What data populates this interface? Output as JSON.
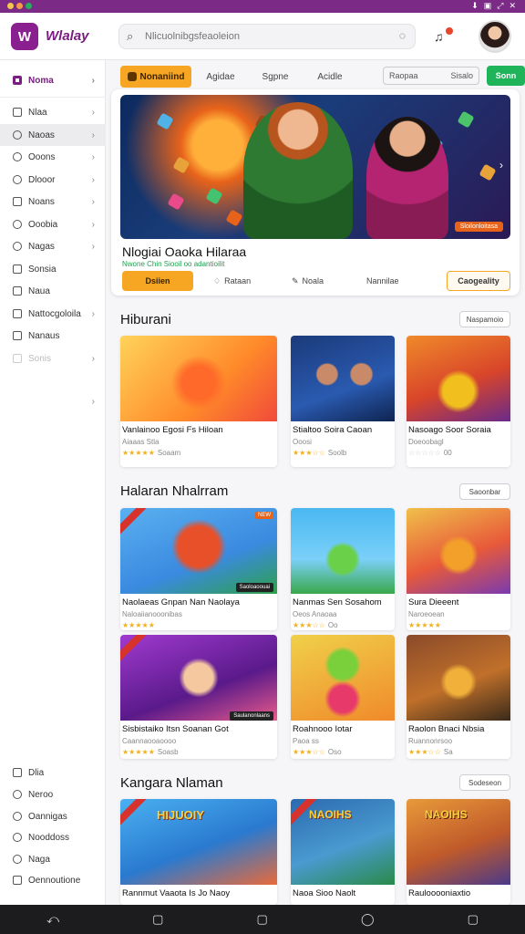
{
  "app": {
    "logo_text": "Wlalay",
    "logo_mark": "W"
  },
  "search": {
    "placeholder": "Nlicuolnibgsfeaoleion"
  },
  "colors": {
    "brand": "#7a1d80",
    "accent": "#f6a623",
    "green": "#1fb35a"
  },
  "sidebar": {
    "items": [
      {
        "label": "Noma",
        "icon": "home-icon"
      },
      {
        "label": "Nlaa",
        "icon": "grid-icon"
      },
      {
        "label": "Naoas",
        "icon": "bell-icon"
      },
      {
        "label": "Ooons",
        "icon": "star-icon"
      },
      {
        "label": "Dlooor",
        "icon": "folder-icon"
      },
      {
        "label": "Noans",
        "icon": "list-icon"
      },
      {
        "label": "Ooobia",
        "icon": "chat-icon"
      },
      {
        "label": "Nagas",
        "icon": "tag-icon"
      },
      {
        "label": "Sonsia",
        "icon": "gift-icon"
      },
      {
        "label": "Naua",
        "icon": "mail-icon"
      },
      {
        "label": "Nattocgoloila",
        "icon": "trophy-icon"
      },
      {
        "label": "Nanaus",
        "icon": "doc-icon"
      },
      {
        "label": "Sonis",
        "icon": "faded-icon"
      }
    ],
    "bottom_items": [
      {
        "label": "Dlia",
        "icon": "info-icon"
      },
      {
        "label": "Neroo",
        "icon": "help-icon"
      },
      {
        "label": "Oannigas",
        "icon": "settings-icon"
      },
      {
        "label": "Nooddoss",
        "icon": "user-icon"
      },
      {
        "label": "Naga",
        "icon": "globe-icon"
      },
      {
        "label": "Oennoutione",
        "icon": "logout-icon"
      }
    ]
  },
  "tabs": {
    "items": [
      "Nonaniind",
      "Agidae",
      "Sgpne",
      "Acidle"
    ],
    "filter_left": "Raopaa",
    "filter_right": "Sisalo",
    "action": "Sonn"
  },
  "hero": {
    "title": "Nlogiai Oaoka Hilaraa",
    "subtitle": "Nwone Chin Siooil oo adantioilit",
    "badge": "Sloilonloitasa",
    "actions": [
      "Dsiien",
      "Rataan",
      "Noala",
      "Nannilae",
      "Caogeality"
    ]
  },
  "sections": [
    {
      "title": "Hiburani",
      "button": "Naspamoio",
      "cards": [
        {
          "title": "Vanlainoo Egosi Fs Hiloan",
          "meta": "Aiaaas Stla",
          "stars": "★★★★★",
          "count": "Soaam"
        },
        {
          "title": "Stialtoo Soira Caoan",
          "meta": "Ooosi",
          "stars": "★★★☆☆",
          "count": "Soolb"
        },
        {
          "title": "Nasoago Soor Soraia",
          "meta": "Doeoobagl",
          "stars": "☆☆☆☆☆",
          "count": "00"
        }
      ]
    },
    {
      "title": "Halaran Nhalrram",
      "button": "Saoonbar",
      "cards": [
        {
          "title": "Naolaeas Gnpan Nan Naolaya",
          "meta": "Naloaiianooonibas",
          "stars": "★★★★★",
          "count": "",
          "tag": "Saoloaoouai",
          "badge": "NEW"
        },
        {
          "title": "Nanmas Sen Sosahom",
          "meta": "Oeos Anaoaa",
          "stars": "★★★☆☆",
          "count": "Oo",
          "tag": ""
        },
        {
          "title": "Sura Dieeent",
          "meta": "Naroeoean",
          "stars": "★★★★★",
          "count": "",
          "tag": ""
        },
        {
          "title": "Sisbistaiko Itsn Soanan Got",
          "meta": "Caannaooaoooo",
          "stars": "★★★★★",
          "count": "Soasb",
          "tag": "Saulanonlaans"
        },
        {
          "title": "Roahnooo Iotar",
          "meta": "Paoa ss",
          "stars": "★★★☆☆",
          "count": "Oso",
          "tag": ""
        },
        {
          "title": "Raolon Bnaci Nbsia",
          "meta": "Ruannonrsoo",
          "stars": "★★★☆☆",
          "count": "Sa",
          "tag": ""
        }
      ]
    },
    {
      "title": "Kangara Nlaman",
      "button": "Sodeseon",
      "cards": [
        {
          "title": "Rannmut Vaaota Is Jo Naoy",
          "thumb_text": "HIJUOIY"
        },
        {
          "title": "Naoa Sioo Naolt",
          "thumb_text": "NAOIHS"
        },
        {
          "title": "Raulooooniaxtio",
          "thumb_text": "NAOIHS"
        }
      ]
    }
  ]
}
